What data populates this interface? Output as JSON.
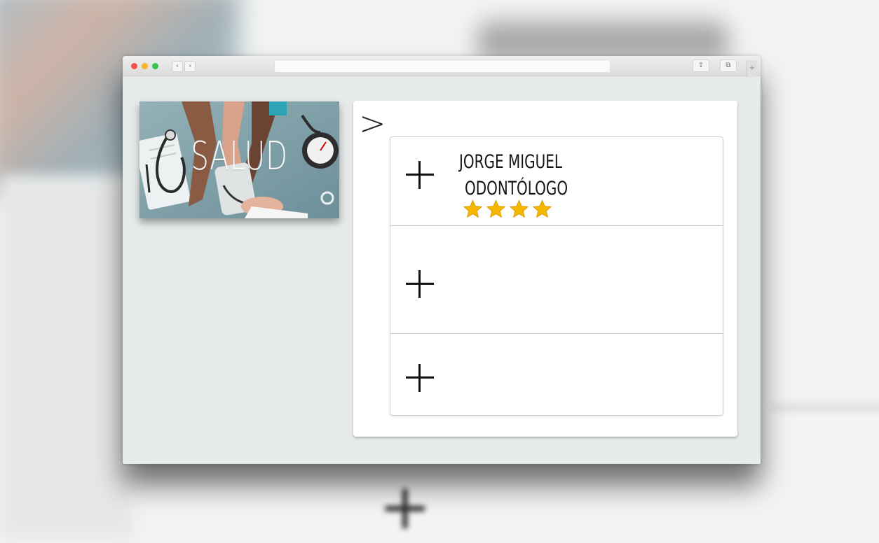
{
  "browser": {
    "nav_back": "‹",
    "nav_forward": "›",
    "url": "",
    "share_icon": "share-icon",
    "tabs_icon": "tabs-icon",
    "new_tab": "+"
  },
  "category": {
    "title": "SALUD",
    "image_icon": "medical-checkup-photo"
  },
  "panel": {
    "chevron": ">",
    "items": [
      {
        "expand_icon": "plus-icon",
        "name": "JORGE MIGUEL",
        "role": "ODONTÓLOGO",
        "rating": 4
      },
      {
        "expand_icon": "plus-icon"
      },
      {
        "expand_icon": "plus-icon"
      }
    ]
  },
  "colors": {
    "star": "#f5b800",
    "panel_bg": "#ffffff",
    "window_bg": "#e6eaea"
  }
}
